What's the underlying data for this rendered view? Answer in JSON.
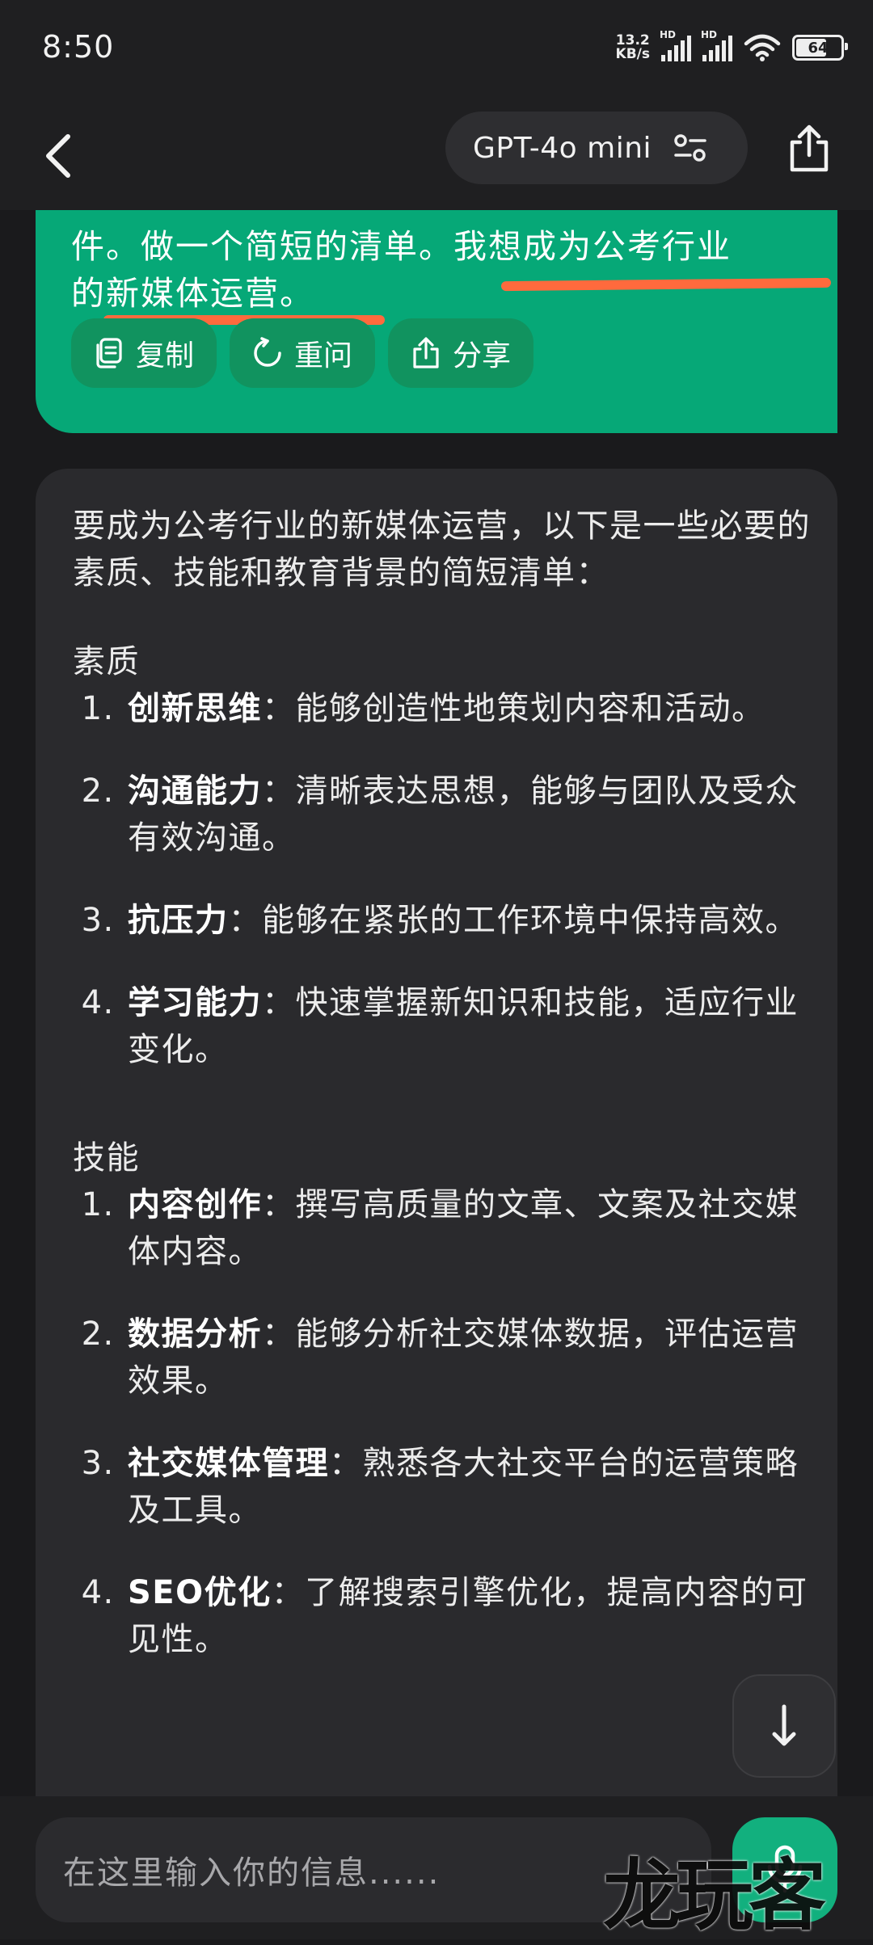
{
  "status_bar": {
    "time": "8:50",
    "net_speed_value": "13.2",
    "net_speed_unit": "KB/s",
    "sim1_label": "HD",
    "sim2_label": "HD",
    "battery_level": "64"
  },
  "header": {
    "back_icon": "chevron-left-icon",
    "model_name": "GPT-4o mini",
    "model_settings_icon": "sliders-icon",
    "share_icon": "share-icon"
  },
  "user_message": {
    "line1": "件。做一个简短的清单。我想成为公考行业",
    "line2": "的新媒体运营。",
    "highlight_color": "#ff6a3d",
    "actions": [
      {
        "label": "复制",
        "icon": "copy-icon"
      },
      {
        "label": "重问",
        "icon": "refresh-icon"
      },
      {
        "label": "分享",
        "icon": "share-icon"
      }
    ]
  },
  "assistant_message": {
    "intro": "要成为公考行业的新媒体运营，以下是一些必要的素质、技能和教育背景的简短清单：",
    "sections": [
      {
        "title": "素质",
        "items": [
          {
            "term": "创新思维",
            "desc": "：能够创造性地策划内容和活动。"
          },
          {
            "term": "沟通能力",
            "desc": "：清晰表达思想，能够与团队及受众有效沟通。"
          },
          {
            "term": "抗压力",
            "desc": "：能够在紧张的工作环境中保持高效。"
          },
          {
            "term": "学习能力",
            "desc": "：快速掌握新知识和技能，适应行业变化。"
          }
        ]
      },
      {
        "title": "技能",
        "items": [
          {
            "term": "内容创作",
            "desc": "：撰写高质量的文章、文案及社交媒体内容。"
          },
          {
            "term": "数据分析",
            "desc": "：能够分析社交媒体数据，评估运营效果。"
          },
          {
            "term": "社交媒体管理",
            "desc": "：熟悉各大社交平台的运营策略及工具。"
          },
          {
            "term": "SEO优化",
            "desc": "：了解搜索引擎优化，提高内容的可见性。"
          }
        ]
      }
    ]
  },
  "scroll_button_icon": "arrow-down-icon",
  "composer": {
    "placeholder": "在这里输入你的信息......",
    "send_icon": "microphone-icon"
  },
  "watermark": "龙玩客",
  "colors": {
    "accent_green": "#06a877",
    "background": "#1a1a1c",
    "card": "#2a2a2d"
  }
}
